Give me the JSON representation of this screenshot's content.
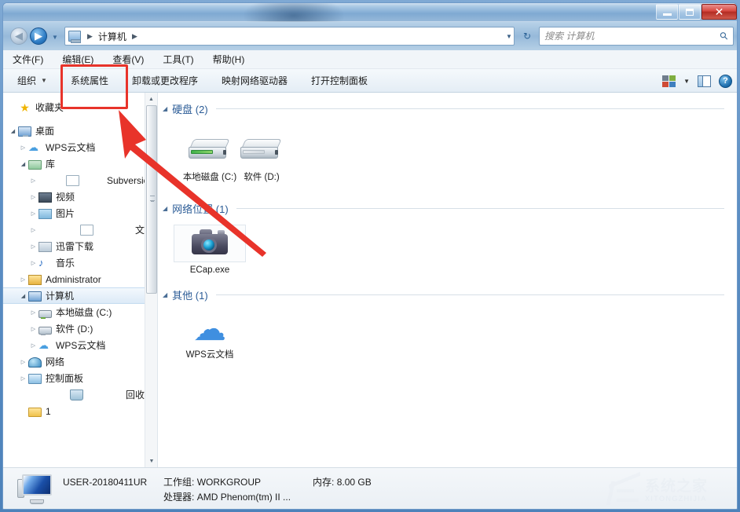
{
  "window": {
    "titlebar": {
      "title": "",
      "minimize_label": "最小化",
      "maximize_label": "最大化",
      "close_label": "关闭"
    }
  },
  "addressbar": {
    "back_label": "后退",
    "forward_label": "前进",
    "recent_dropdown_label": "最近浏览的位置",
    "breadcrumbs": [
      "计算机"
    ],
    "separator": "▶",
    "dropdown_label": "▾",
    "refresh_label": "刷新"
  },
  "search": {
    "placeholder": "搜索 计算机",
    "value": "",
    "icon": "search-icon"
  },
  "menubar": {
    "items": [
      {
        "label": "文件(F)"
      },
      {
        "label": "编辑(E)"
      },
      {
        "label": "查看(V)"
      },
      {
        "label": "工具(T)"
      },
      {
        "label": "帮助(H)"
      }
    ]
  },
  "toolbar": {
    "organize_label": "组织",
    "organize_caret": "▼",
    "items": [
      {
        "label": "系统属性"
      },
      {
        "label": "卸载或更改程序"
      },
      {
        "label": "映射网络驱动器"
      },
      {
        "label": "打开控制面板"
      }
    ],
    "view_icon": "view-options-icon",
    "view_caret": "▼",
    "preview_pane_icon": "preview-pane-icon",
    "help_icon": "help-icon",
    "help_glyph": "?"
  },
  "navigation": {
    "scrollbar": {
      "up_arrow": "▲",
      "down_arrow": "▼"
    },
    "items": [
      {
        "label": "收藏夹",
        "icon": "star-icon",
        "indent": 0,
        "expander": "",
        "selected": false,
        "spacer_after": true
      },
      {
        "label": "桌面",
        "icon": "desktop-icon",
        "indent": 0,
        "expander": "open",
        "selected": false
      },
      {
        "label": "WPS云文档",
        "icon": "cloud-icon",
        "indent": 1,
        "expander": "closed",
        "selected": false
      },
      {
        "label": "库",
        "icon": "library-folder-icon",
        "indent": 1,
        "expander": "open",
        "selected": false
      },
      {
        "label": "Subversion",
        "icon": "doc-folder-icon",
        "indent": 2,
        "expander": "closed",
        "selected": false
      },
      {
        "label": "视频",
        "icon": "video-icon",
        "indent": 2,
        "expander": "closed",
        "selected": false
      },
      {
        "label": "图片",
        "icon": "picture-icon",
        "indent": 2,
        "expander": "closed",
        "selected": false
      },
      {
        "label": "文档",
        "icon": "document-icon",
        "indent": 2,
        "expander": "closed",
        "selected": false
      },
      {
        "label": "迅雷下载",
        "icon": "download-icon",
        "indent": 2,
        "expander": "closed",
        "selected": false
      },
      {
        "label": "音乐",
        "icon": "music-icon",
        "indent": 2,
        "expander": "closed",
        "selected": false
      },
      {
        "label": "Administrator",
        "icon": "user-icon",
        "indent": 1,
        "expander": "closed",
        "selected": false
      },
      {
        "label": "计算机",
        "icon": "computer-icon",
        "indent": 1,
        "expander": "open",
        "selected": true
      },
      {
        "label": "本地磁盘 (C:)",
        "icon": "harddisk-icon",
        "indent": 2,
        "expander": "closed",
        "selected": false
      },
      {
        "label": "软件 (D:)",
        "icon": "harddisk-icon",
        "indent": 2,
        "expander": "closed",
        "selected": false
      },
      {
        "label": "WPS云文档",
        "icon": "cloud-icon",
        "indent": 2,
        "expander": "closed",
        "selected": false
      },
      {
        "label": "网络",
        "icon": "network-icon",
        "indent": 1,
        "expander": "closed",
        "selected": false
      },
      {
        "label": "控制面板",
        "icon": "control-panel-icon",
        "indent": 1,
        "expander": "closed",
        "selected": false
      },
      {
        "label": "回收站",
        "icon": "recycle-bin-icon",
        "indent": 1,
        "expander": "",
        "selected": false
      },
      {
        "label": "1",
        "icon": "folder-icon",
        "indent": 1,
        "expander": "",
        "selected": false
      }
    ]
  },
  "content": {
    "groups": [
      {
        "title": "硬盘 (2)",
        "caret": "◢",
        "items": [
          {
            "label": "本地磁盘 (C:)",
            "icon": "harddisk-icon",
            "used_bar": true,
            "selected": false
          },
          {
            "label": "软件 (D:)",
            "icon": "harddisk-icon",
            "used_bar": false,
            "selected": false
          }
        ]
      },
      {
        "title": "网络位置 (1)",
        "caret": "◢",
        "items": [
          {
            "label": "ECap.exe",
            "icon": "camera-icon",
            "selected": true
          }
        ]
      },
      {
        "title": "其他 (1)",
        "caret": "◢",
        "items": [
          {
            "label": "WPS云文档",
            "icon": "wps-cloud-icon",
            "selected": false
          }
        ]
      }
    ]
  },
  "statusbar": {
    "icon": "computer-icon",
    "computer_name": "USER-20180411UR",
    "workgroup_key": "工作组:",
    "workgroup_value": "WORKGROUP",
    "memory_key": "内存:",
    "memory_value": "8.00 GB",
    "processor_key": "处理器:",
    "processor_value": "AMD Phenom(tm) II ..."
  },
  "watermark": {
    "cn": "系统之家",
    "en": "XITONGZHIJIA"
  },
  "annotations": {
    "rect_target": "系统属性",
    "arrow_color": "#e8332a",
    "rect_color": "#e8332a"
  }
}
